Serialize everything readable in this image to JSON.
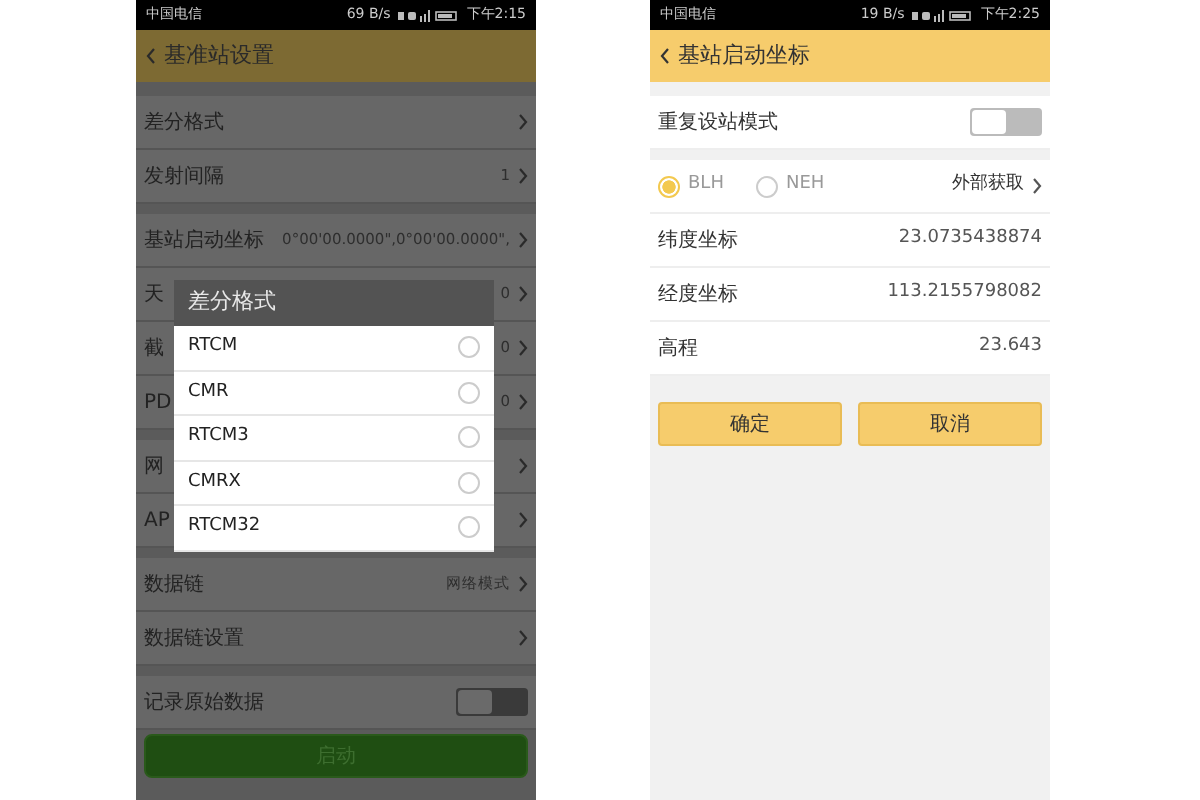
{
  "screens": [
    {
      "status_bar": {
        "carrier": "中国电信",
        "speed": "69 B/s",
        "time": "下午2:15"
      },
      "header": {
        "title": "基准站设置"
      },
      "sections": [
        [
          {
            "kind": "nav",
            "label": "差分格式"
          },
          {
            "kind": "nav",
            "label": "发射间隔",
            "value": "1"
          }
        ],
        [
          {
            "kind": "nav",
            "label": "基站启动坐标",
            "value": "0°00'00.0000\",0°00'00.0000\","
          },
          {
            "kind": "nav",
            "label": "天",
            "value": "0"
          },
          {
            "kind": "nav",
            "label": "截",
            "value": "0"
          },
          {
            "kind": "nav",
            "label": "PD",
            "value": "0"
          }
        ],
        [
          {
            "kind": "nav",
            "label": "网"
          },
          {
            "kind": "nav",
            "label": "AP"
          }
        ],
        [
          {
            "kind": "nav",
            "label": "数据链",
            "value": "网络模式"
          },
          {
            "kind": "nav",
            "label": "数据链设置"
          }
        ],
        [
          {
            "kind": "toggle",
            "label": "记录原始数据",
            "on": false
          }
        ]
      ],
      "action_button": "启动",
      "dialog": {
        "title": "差分格式",
        "options": [
          {
            "label": "RTCM",
            "selected": false
          },
          {
            "label": "CMR",
            "selected": false
          },
          {
            "label": "RTCM3",
            "selected": false
          },
          {
            "label": "CMRX",
            "selected": false
          },
          {
            "label": "RTCM32",
            "selected": false
          }
        ]
      }
    },
    {
      "status_bar": {
        "carrier": "中国电信",
        "speed": "19 B/s",
        "time": "下午2:25"
      },
      "header": {
        "title": "基站启动坐标"
      },
      "repeat_mode": {
        "label": "重复设站模式",
        "on": false
      },
      "coord_types": [
        {
          "label": "BLH",
          "selected": true
        },
        {
          "label": "NEH",
          "selected": false
        }
      ],
      "external_link": "外部获取",
      "fields": [
        {
          "label": "纬度坐标",
          "value": "23.0735438874"
        },
        {
          "label": "经度坐标",
          "value": "113.2155798082"
        },
        {
          "label": "高程",
          "value": "23.643"
        }
      ],
      "buttons": [
        "确定",
        "取消"
      ]
    }
  ]
}
